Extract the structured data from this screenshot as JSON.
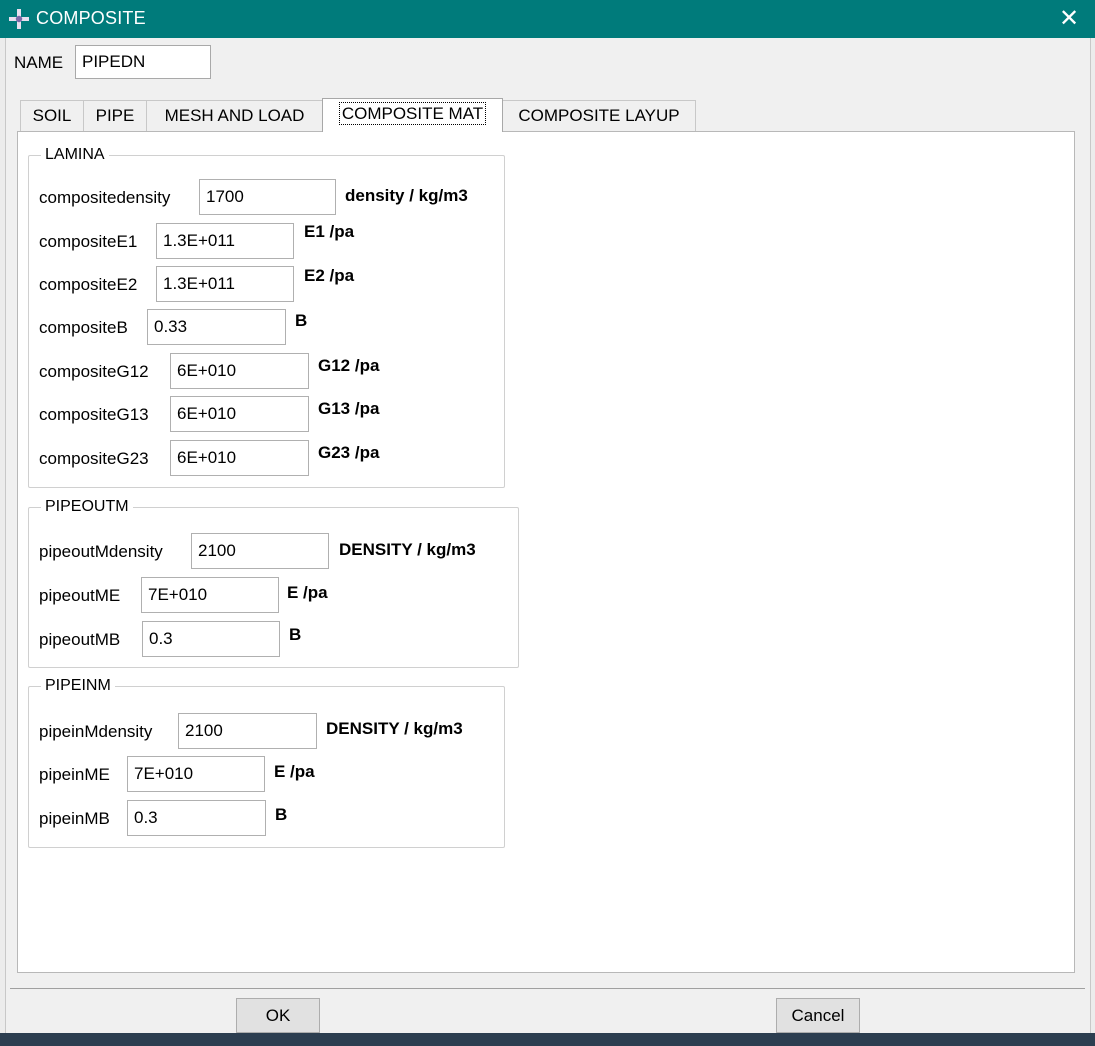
{
  "window": {
    "title": "COMPOSITE",
    "close_glyph": "✕"
  },
  "name": {
    "label": "NAME",
    "value": "PIPEDN"
  },
  "tabs": [
    {
      "label": "SOIL",
      "active": false
    },
    {
      "label": "PIPE",
      "active": false
    },
    {
      "label": "MESH AND LOAD",
      "active": false
    },
    {
      "label": "COMPOSITE MAT",
      "active": true
    },
    {
      "label": "COMPOSITE LAYUP",
      "active": false
    }
  ],
  "lamina": {
    "legend": "LAMINA",
    "rows": [
      {
        "label": "compositedensity",
        "value": "1700",
        "unit": "density / kg/m3"
      },
      {
        "label": "compositeE1",
        "value": "1.3E+011",
        "unit": "E1 /pa"
      },
      {
        "label": "compositeE2",
        "value": "1.3E+011",
        "unit": "E2 /pa"
      },
      {
        "label": "compositeB",
        "value": "0.33",
        "unit": "B"
      },
      {
        "label": "compositeG12",
        "value": "6E+010",
        "unit": "G12 /pa"
      },
      {
        "label": "compositeG13",
        "value": "6E+010",
        "unit": "G13 /pa"
      },
      {
        "label": "compositeG23",
        "value": "6E+010",
        "unit": "G23  /pa"
      }
    ]
  },
  "pipeoutm": {
    "legend": "PIPEOUTM",
    "rows": [
      {
        "label": "pipeoutMdensity",
        "value": "2100",
        "unit": "DENSITY  / kg/m3"
      },
      {
        "label": "pipeoutME",
        "value": "7E+010",
        "unit": "E  /pa"
      },
      {
        "label": "pipeoutMB",
        "value": "0.3",
        "unit": "B"
      }
    ]
  },
  "pipeinm": {
    "legend": "PIPEINM",
    "rows": [
      {
        "label": "pipeinMdensity",
        "value": "2100",
        "unit": "DENSITY  / kg/m3"
      },
      {
        "label": "pipeinME",
        "value": "7E+010",
        "unit": "E  /pa"
      },
      {
        "label": "pipeinMB",
        "value": "0.3",
        "unit": "B"
      }
    ]
  },
  "buttons": {
    "ok": "OK",
    "cancel": "Cancel"
  },
  "colors": {
    "titlebar": "#007b7b",
    "dialog_bg": "#f0f0f0",
    "panel_bg": "#ffffff"
  },
  "icons": {
    "app": "app-cross-icon",
    "close": "close-icon"
  }
}
